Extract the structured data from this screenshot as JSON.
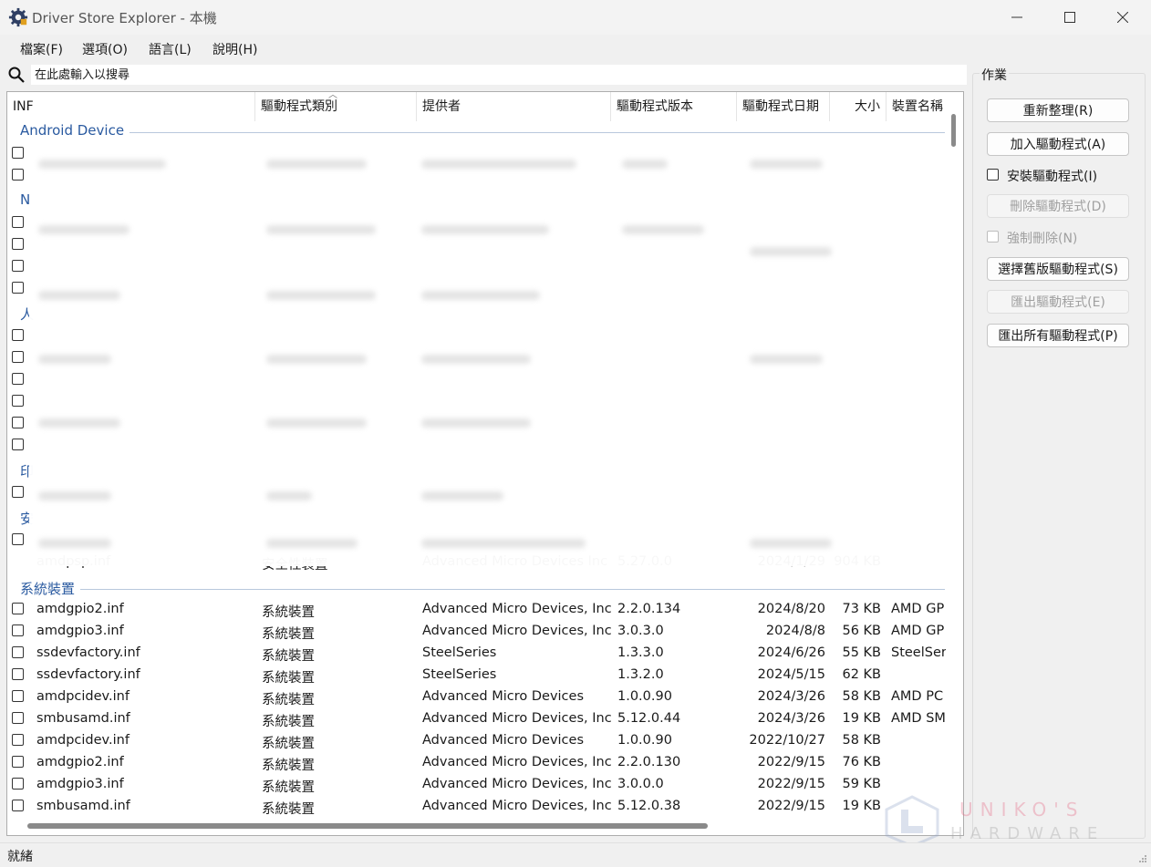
{
  "window": {
    "title": "Driver Store Explorer - 本機",
    "minimize_icon": "minimize-icon",
    "maximize_icon": "maximize-icon",
    "close_icon": "close-icon"
  },
  "menu": [
    "檔案(F)",
    "選項(O)",
    "語言(L)",
    "說明(H)"
  ],
  "search": {
    "placeholder": "在此處輸入以搜尋",
    "value": ""
  },
  "columns": [
    "INF",
    "驅動程式類別",
    "提供者",
    "驅動程式版本",
    "驅動程式日期",
    "大小",
    "裝置名稱"
  ],
  "groups": {
    "android": "Android Device",
    "n_partial": "N",
    "ren_partial": "人",
    "yin_partial": "印",
    "an_partial": "安",
    "system": "系統裝置"
  },
  "partial_row": {
    "inf": "amdpsp.inf",
    "class": "安全性裝置",
    "provider": "Advanced Micro Devices Inc",
    "version": "5.27.0.0",
    "date": "2024/1/29",
    "size": "904 KB"
  },
  "system_rows": [
    {
      "inf": "amdgpio2.inf",
      "class": "系統裝置",
      "provider": "Advanced Micro Devices, Inc",
      "version": "2.2.0.134",
      "date": "2024/8/20",
      "size": "73 KB",
      "device": "AMD GP"
    },
    {
      "inf": "amdgpio3.inf",
      "class": "系統裝置",
      "provider": "Advanced Micro Devices, Inc.",
      "version": "3.0.3.0",
      "date": "2024/8/8",
      "size": "56 KB",
      "device": "AMD GP"
    },
    {
      "inf": "ssdevfactory.inf",
      "class": "系統裝置",
      "provider": "SteelSeries",
      "version": "1.3.3.0",
      "date": "2024/6/26",
      "size": "55 KB",
      "device": "SteelSer"
    },
    {
      "inf": "ssdevfactory.inf",
      "class": "系統裝置",
      "provider": "SteelSeries",
      "version": "1.3.2.0",
      "date": "2024/5/15",
      "size": "62 KB",
      "device": ""
    },
    {
      "inf": "amdpcidev.inf",
      "class": "系統裝置",
      "provider": "Advanced Micro Devices",
      "version": "1.0.0.90",
      "date": "2024/3/26",
      "size": "58 KB",
      "device": "AMD PC"
    },
    {
      "inf": "smbusamd.inf",
      "class": "系統裝置",
      "provider": "Advanced Micro Devices, Inc",
      "version": "5.12.0.44",
      "date": "2024/3/26",
      "size": "19 KB",
      "device": "AMD SM"
    },
    {
      "inf": "amdpcidev.inf",
      "class": "系統裝置",
      "provider": "Advanced Micro Devices",
      "version": "1.0.0.90",
      "date": "2022/10/27",
      "size": "58 KB",
      "device": ""
    },
    {
      "inf": "amdgpio2.inf",
      "class": "系統裝置",
      "provider": "Advanced Micro Devices, Inc",
      "version": "2.2.0.130",
      "date": "2022/9/15",
      "size": "76 KB",
      "device": ""
    },
    {
      "inf": "amdgpio3.inf",
      "class": "系統裝置",
      "provider": "Advanced Micro Devices, Inc.",
      "version": "3.0.0.0",
      "date": "2022/9/15",
      "size": "59 KB",
      "device": ""
    },
    {
      "inf": "smbusamd.inf",
      "class": "系統裝置",
      "provider": "Advanced Micro Devices, Inc",
      "version": "5.12.0.38",
      "date": "2022/9/15",
      "size": "19 KB",
      "device": ""
    }
  ],
  "actions": {
    "legend": "作業",
    "refresh": "重新整理(R)",
    "add_driver": "加入驅動程式(A)",
    "install_driver": "安裝驅動程式(I)",
    "delete_driver": "刪除驅動程式(D)",
    "force_delete": "強制刪除(N)",
    "select_old": "選擇舊版驅動程式(S)",
    "export_driver": "匯出驅動程式(E)",
    "export_all": "匯出所有驅動程式(P)"
  },
  "status": "就緒",
  "watermark": {
    "line1": "UNIKO'S",
    "line2": "HARDWARE"
  },
  "colors": {
    "group_title": "#2a5aa0",
    "disabled_text": "#a0a0a0"
  }
}
